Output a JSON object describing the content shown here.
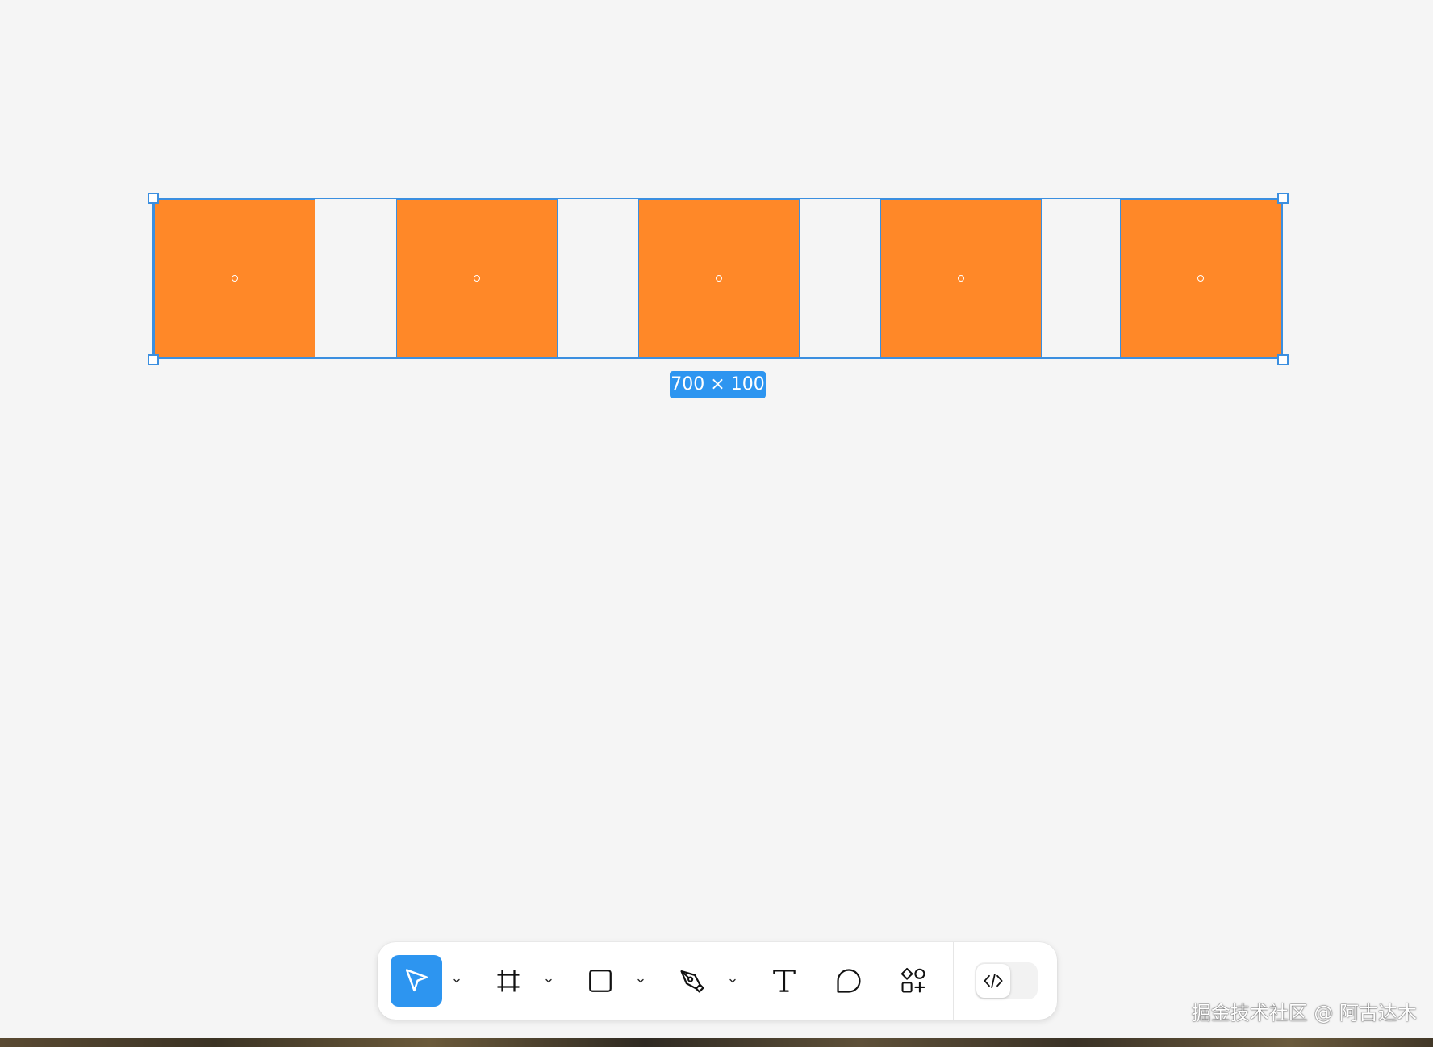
{
  "canvas": {
    "background": "#f5f5f5"
  },
  "frame": {
    "size_label": "700 × 100",
    "selection_color": "#3b8fe0",
    "squares": [
      {
        "fill": "#ff8828"
      },
      {
        "fill": "#ff8828"
      },
      {
        "fill": "#ff8828"
      },
      {
        "fill": "#ff8828"
      },
      {
        "fill": "#ff8828"
      }
    ]
  },
  "toolbar": {
    "active_color": "#2d95f0",
    "tools": [
      {
        "name": "move-tool",
        "icon": "cursor-arrow-icon",
        "active": true,
        "has_dropdown": true
      },
      {
        "name": "frame-tool",
        "icon": "frame-hash-icon",
        "active": false,
        "has_dropdown": true
      },
      {
        "name": "shape-tool",
        "icon": "rectangle-icon",
        "active": false,
        "has_dropdown": true
      },
      {
        "name": "pen-tool",
        "icon": "pen-nib-icon",
        "active": false,
        "has_dropdown": true
      },
      {
        "name": "text-tool",
        "icon": "text-t-icon",
        "active": false,
        "has_dropdown": false
      },
      {
        "name": "comment-tool",
        "icon": "comment-bubble-icon",
        "active": false,
        "has_dropdown": false
      },
      {
        "name": "resources-tool",
        "icon": "shapes-plus-icon",
        "active": false,
        "has_dropdown": false
      }
    ],
    "dev_mode": {
      "icon": "code-brackets-icon",
      "enabled": false
    }
  },
  "watermark": {
    "text": "掘金技术社区 @ 阿古达木"
  }
}
